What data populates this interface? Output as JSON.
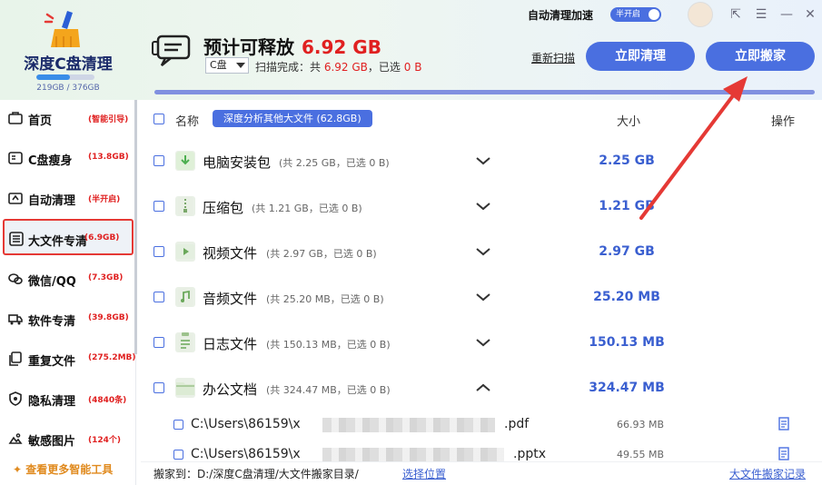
{
  "app": {
    "name": "深度C盘清理",
    "disk_usage": "219GB / 376GB",
    "disk_fraction": 0.58
  },
  "header": {
    "auto_clean_label": "自动清理加速",
    "toggle_label": "半开启",
    "summary_prefix": "预计可释放",
    "summary_size": "6.92 GB",
    "disk_value": "C盘",
    "scan_prefix": "扫描完成：共",
    "scan_total": "6.92 GB",
    "scan_selected_prefix": "，已选",
    "scan_selected": "0 B",
    "rescan_label": "重新扫描",
    "clean_button": "立即清理",
    "move_button": "立即搬家"
  },
  "sidebar": {
    "items": [
      {
        "label": "首页",
        "tag": "(智能引导)",
        "icon": "briefcase-icon"
      },
      {
        "label": "C盘瘦身",
        "tag": "(13.8GB)",
        "icon": "drive-icon"
      },
      {
        "label": "自动清理",
        "tag": "(半开启)",
        "icon": "broom-icon"
      },
      {
        "label": "大文件专清",
        "tag": "(6.9GB)",
        "icon": "list-icon"
      },
      {
        "label": "微信/QQ",
        "tag": "(7.3GB)",
        "icon": "chat-icon"
      },
      {
        "label": "软件专清",
        "tag": "(39.8GB)",
        "icon": "truck-icon"
      },
      {
        "label": "重复文件",
        "tag": "(275.2MB)",
        "icon": "copy-icon"
      },
      {
        "label": "隐私清理",
        "tag": "(4840条)",
        "icon": "shield-icon"
      },
      {
        "label": "敏感图片",
        "tag": "(124个)",
        "icon": "image-icon"
      }
    ],
    "more_tools": "查看更多智能工具"
  },
  "list": {
    "header_name": "名称",
    "deep_analyze": "深度分析其他大文件 (62.8GB)",
    "header_size": "大小",
    "header_op": "操作",
    "categories": [
      {
        "name": "电脑安装包",
        "detail": "(共 2.25 GB，已选 0 B)",
        "size": "2.25 GB",
        "expanded": false
      },
      {
        "name": "压缩包",
        "detail": "(共 1.21 GB，已选 0 B)",
        "size": "1.21 GB",
        "expanded": false
      },
      {
        "name": "视频文件",
        "detail": "(共 2.97 GB，已选 0 B)",
        "size": "2.97 GB",
        "expanded": false
      },
      {
        "name": "音频文件",
        "detail": "(共 25.20 MB，已选 0 B)",
        "size": "25.20 MB",
        "expanded": false
      },
      {
        "name": "日志文件",
        "detail": "(共 150.13 MB，已选 0 B)",
        "size": "150.13 MB",
        "expanded": false
      },
      {
        "name": "办公文档",
        "detail": "(共 324.47 MB，已选 0 B)",
        "size": "324.47 MB",
        "expanded": true
      }
    ],
    "files": [
      {
        "path": "C:\\Users\\86159\\x",
        "ext": ".pdf",
        "size": "66.93 MB"
      },
      {
        "path": "C:\\Users\\86159\\x",
        "ext": ".pptx",
        "size": "49.55 MB"
      }
    ]
  },
  "footer": {
    "move_to_label": "搬家到：",
    "move_to_path": "D:/深度C盘清理/大文件搬家目录/",
    "choose_location": "选择位置",
    "history": "大文件搬家记录"
  },
  "colors": {
    "accent": "#4a6fe0",
    "highlight_red": "#e02020",
    "annotation_arrow": "#e53935"
  }
}
